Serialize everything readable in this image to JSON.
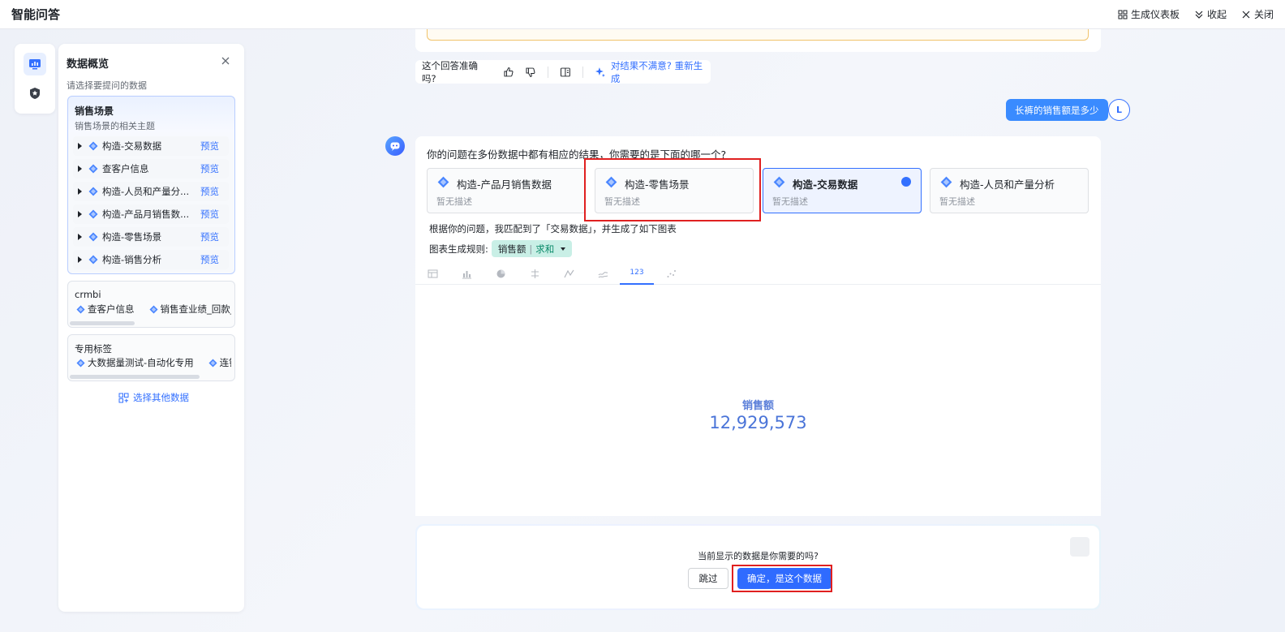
{
  "app": {
    "title": "智能问答",
    "actions": [
      "生成仪表板",
      "收起",
      "关闭"
    ]
  },
  "panel": {
    "title": "数据概览",
    "subtitle": "请选择要提问的数据",
    "sales_group": {
      "title": "销售场景",
      "desc": "销售场景的相关主题",
      "preview_label": "预览",
      "items": [
        "构造-交易数据",
        "查客户信息",
        "构造-人员和产量分...",
        "构造-产品月销售数...",
        "构造-零售场景",
        "构造-销售分析"
      ]
    },
    "crmbi_group": {
      "title": "crmbi",
      "chips": [
        "查客户信息",
        "销售查业绩_回款_目"
      ]
    },
    "tag_group": {
      "title": "专用标签",
      "chips": [
        "大数据量测试-自动化专用",
        "连锁"
      ]
    },
    "choose_other": "选择其他数据"
  },
  "feedback": {
    "question": "这个回答准确吗?",
    "regenerate": "对结果不满意? 重新生成"
  },
  "user": {
    "message": "长裤的销售额是多少",
    "avatar": "L"
  },
  "answer": {
    "question": "你的问题在多份数据中都有相应的结果，你需要的是下面的哪一个?",
    "datasets": [
      {
        "name": "构造-产品月销售数据",
        "desc": "暂无描述",
        "selected": false
      },
      {
        "name": "构造-零售场景",
        "desc": "暂无描述",
        "selected": false
      },
      {
        "name": "构造-交易数据",
        "desc": "暂无描述",
        "selected": true
      },
      {
        "name": "构造-人员和产量分析",
        "desc": "暂无描述",
        "selected": false
      }
    ],
    "match_text": "根据你的问题，我匹配到了「交易数据」，并生成了如下图表",
    "rule_label": "图表生成规则:",
    "rule_field": "销售额",
    "rule_agg": "求和",
    "chart_tabs": [
      "table-icon",
      "bar-chart-icon",
      "pie-chart-icon",
      "scatter-icon",
      "line-chart-icon",
      "area-chart-icon",
      "indicator-icon",
      "dots-icon"
    ],
    "active_tab_label": "123",
    "metric_label": "销售额",
    "metric_value": "12,929,573"
  },
  "confirm": {
    "question": "当前显示的数据是你需要的吗?",
    "skip": "跳过",
    "ok": "确定，是这个数据"
  },
  "colors": {
    "accent": "#3370ff",
    "user_bubble": "#3a8bff",
    "highlight": "#e02020"
  }
}
